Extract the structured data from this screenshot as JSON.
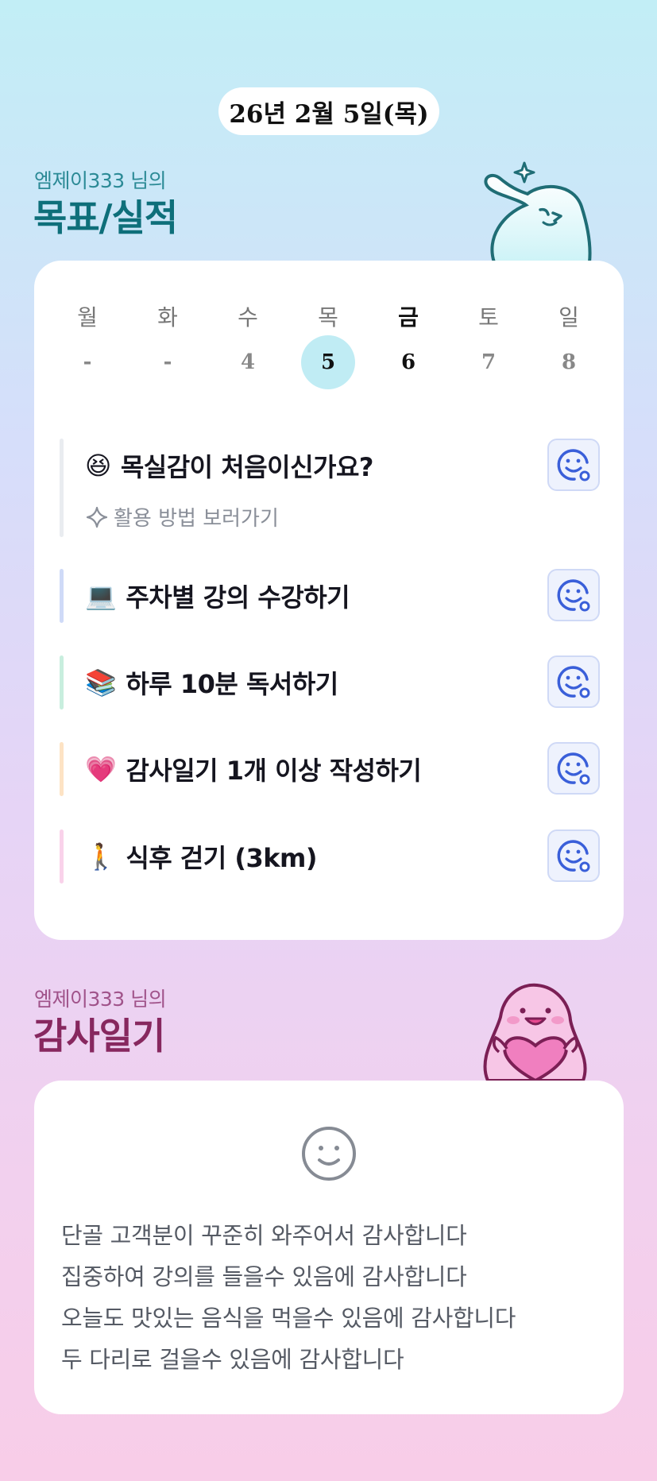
{
  "date": "26년 2월 5일(목)",
  "goals_section": {
    "owner": "엠제이333 님의",
    "title": "목표/실적"
  },
  "week": {
    "days": [
      {
        "name": "월",
        "num": "-"
      },
      {
        "name": "화",
        "num": "-"
      },
      {
        "name": "수",
        "num": "4"
      },
      {
        "name": "목",
        "num": "5"
      },
      {
        "name": "금",
        "num": "6"
      },
      {
        "name": "토",
        "num": "7"
      },
      {
        "name": "일",
        "num": "8"
      }
    ],
    "selected_index": 3,
    "today_index": 4
  },
  "goals": [
    {
      "emoji": "😆",
      "label": "목실감이 처음이신가요?",
      "hint": "활용 방법 보러가기",
      "bar_color": "#e9ecf0"
    },
    {
      "emoji": "💻",
      "label": "주차별 강의 수강하기",
      "bar_color": "#cfdaf7"
    },
    {
      "emoji": "📚",
      "label": "하루 10분 독서하기",
      "bar_color": "#c8eede"
    },
    {
      "emoji": "💗",
      "label": "감사일기 1개 이상 작성하기",
      "bar_color": "#fde3c4"
    },
    {
      "emoji": "🚶",
      "label": "식후 걷기 (3km)",
      "bar_color": "#f9d2ea"
    }
  ],
  "diary_section": {
    "owner": "엠제이333 님의",
    "title": "감사일기"
  },
  "diary": {
    "lines": [
      "단골 고객분이 꾸준히 와주어서 감사합니다",
      "집중하여 강의를 들을수 있음에 감사합니다",
      "오늘도 맛있는 음식을 먹을수 있음에 감사합니다",
      "두 다리로 걸을수 있음에 감사합니다"
    ]
  },
  "colors": {
    "accent": "#3a5fd9",
    "selected_day": "#c0ecf4",
    "goals_title": "#0e6f7a",
    "diary_title": "#87285f"
  }
}
